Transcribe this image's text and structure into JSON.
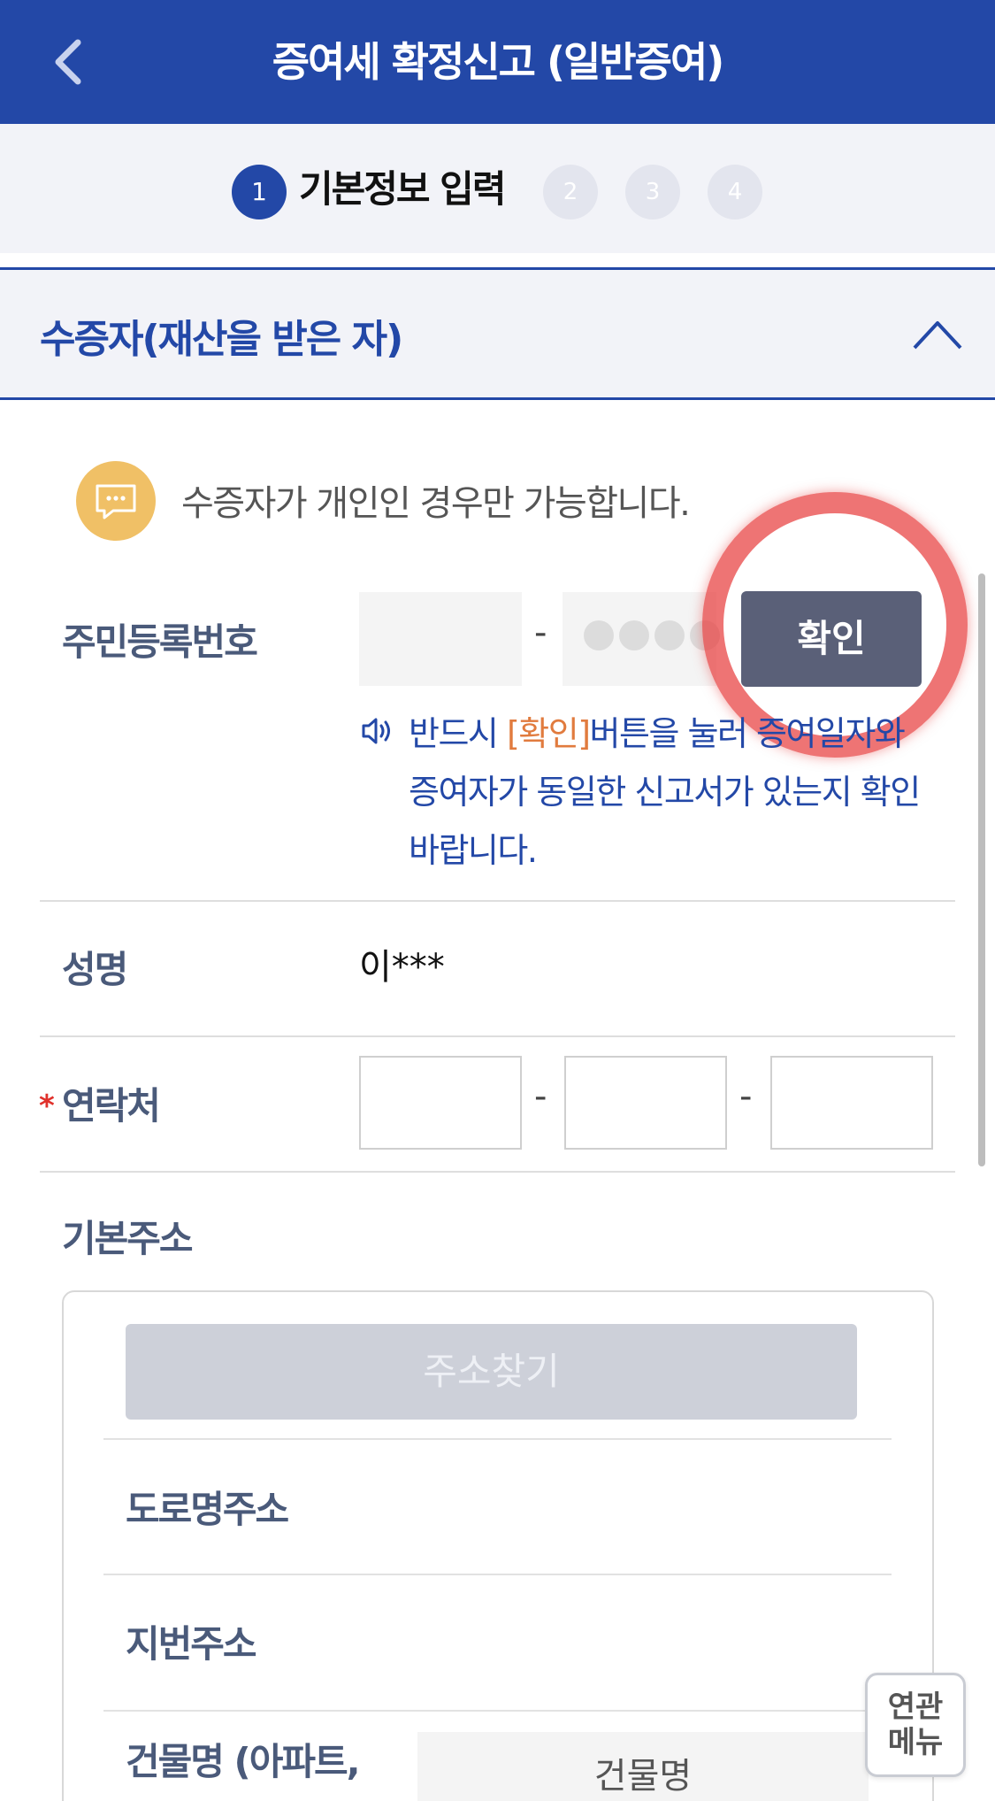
{
  "header": {
    "title": "증여세 확정신고 (일반증여)",
    "color": "#2348a7"
  },
  "steps": {
    "active_number": "1",
    "active_label": "기본정보 입력",
    "others": [
      "2",
      "3",
      "4"
    ]
  },
  "section": {
    "title": "수증자(재산을 받은 자)"
  },
  "info": {
    "text": "수증자가 개인인 경우만 가능합니다."
  },
  "ssn": {
    "label": "주민등록번호",
    "dash": "-",
    "confirm_label": "확인"
  },
  "notice": {
    "pre": "반드시 ",
    "highlight": "[확인]",
    "post": "버튼을 눌러 증여일자와 증여자가 동일한 신고서가 있는지 확인 바랍니다."
  },
  "name": {
    "label": "성명",
    "value": "이***"
  },
  "phone": {
    "required_mark": "*",
    "label": "연락처",
    "dash": "-"
  },
  "address": {
    "label": "기본주소",
    "search_label": "주소찾기",
    "road_label": "도로명주소",
    "lot_label": "지번주소",
    "building_label": "건물명 (아파트, 상가)",
    "building_placeholder": "건물명"
  },
  "related_menu": {
    "line1": "연관",
    "line2": "메뉴"
  },
  "colors": {
    "accent": "#2348a7",
    "highlight": "#e17b3e",
    "info_icon": "#f0c066",
    "confirm_button": "#5a6078",
    "annotation_circle": "#e84646"
  }
}
